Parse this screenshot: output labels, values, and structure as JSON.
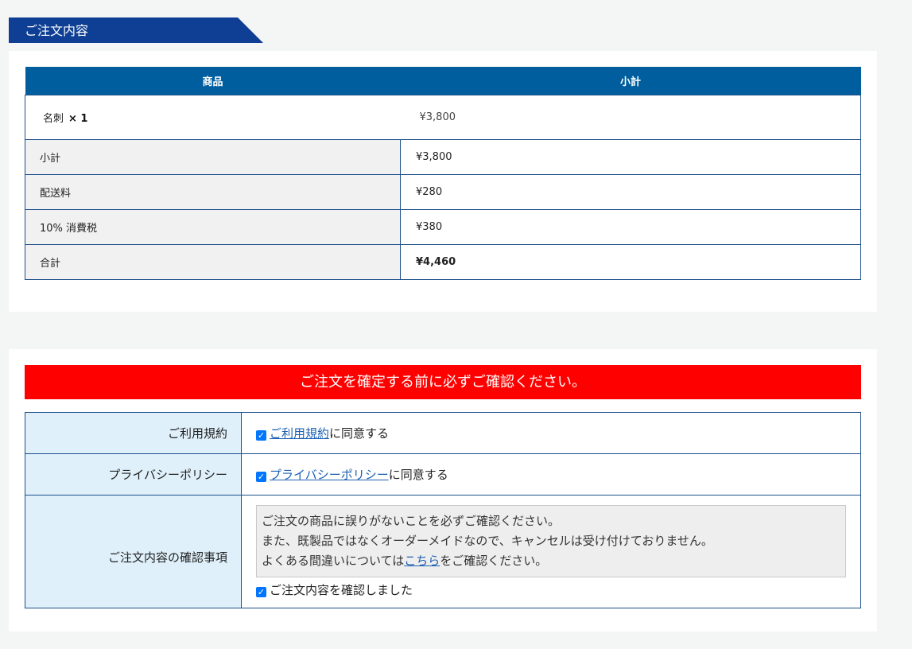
{
  "order_section": {
    "heading": "ご注文内容",
    "table": {
      "headers": [
        "商品",
        "小計"
      ],
      "item": {
        "name": "名刺",
        "qty": "× 1",
        "price": "¥3,800"
      },
      "summary": [
        {
          "label": "小計",
          "value": "¥3,800"
        },
        {
          "label": "配送料",
          "value": "¥280"
        },
        {
          "label": "10% 消費税",
          "value": "¥380"
        },
        {
          "label": "合計",
          "value": "¥4,460"
        }
      ]
    }
  },
  "confirm_section": {
    "banner": "ご注文を確定する前に必ずご確認ください。",
    "terms": {
      "label": "ご利用規約",
      "link": "ご利用規約",
      "suffix": "に同意する",
      "checked": true
    },
    "privacy": {
      "label": "プライバシーポリシー",
      "link": "プライバシーポリシー",
      "suffix": "に同意する",
      "checked": true
    },
    "notes": {
      "label": "ご注文内容の確認事項",
      "line1": "ご注文の商品に誤りがないことを必ずご確認ください。",
      "line2": "また、既製品ではなくオーダーメイドなので、キャンセルは受け付けておりません。",
      "line3_prefix": "よくある間違いについては",
      "line3_link": "こちら",
      "line3_suffix": "をご確認ください。",
      "check_label": "ご注文内容を確認しました",
      "checked": true
    }
  },
  "colors": {
    "heading_bg": "#0e3f94",
    "table_header_bg": "#005e9e",
    "border": "#1c4f8a",
    "banner_bg": "#ff0000",
    "label_bg": "#dff0fa",
    "link": "#1c5fb3",
    "checkbox": "#0075ff"
  }
}
